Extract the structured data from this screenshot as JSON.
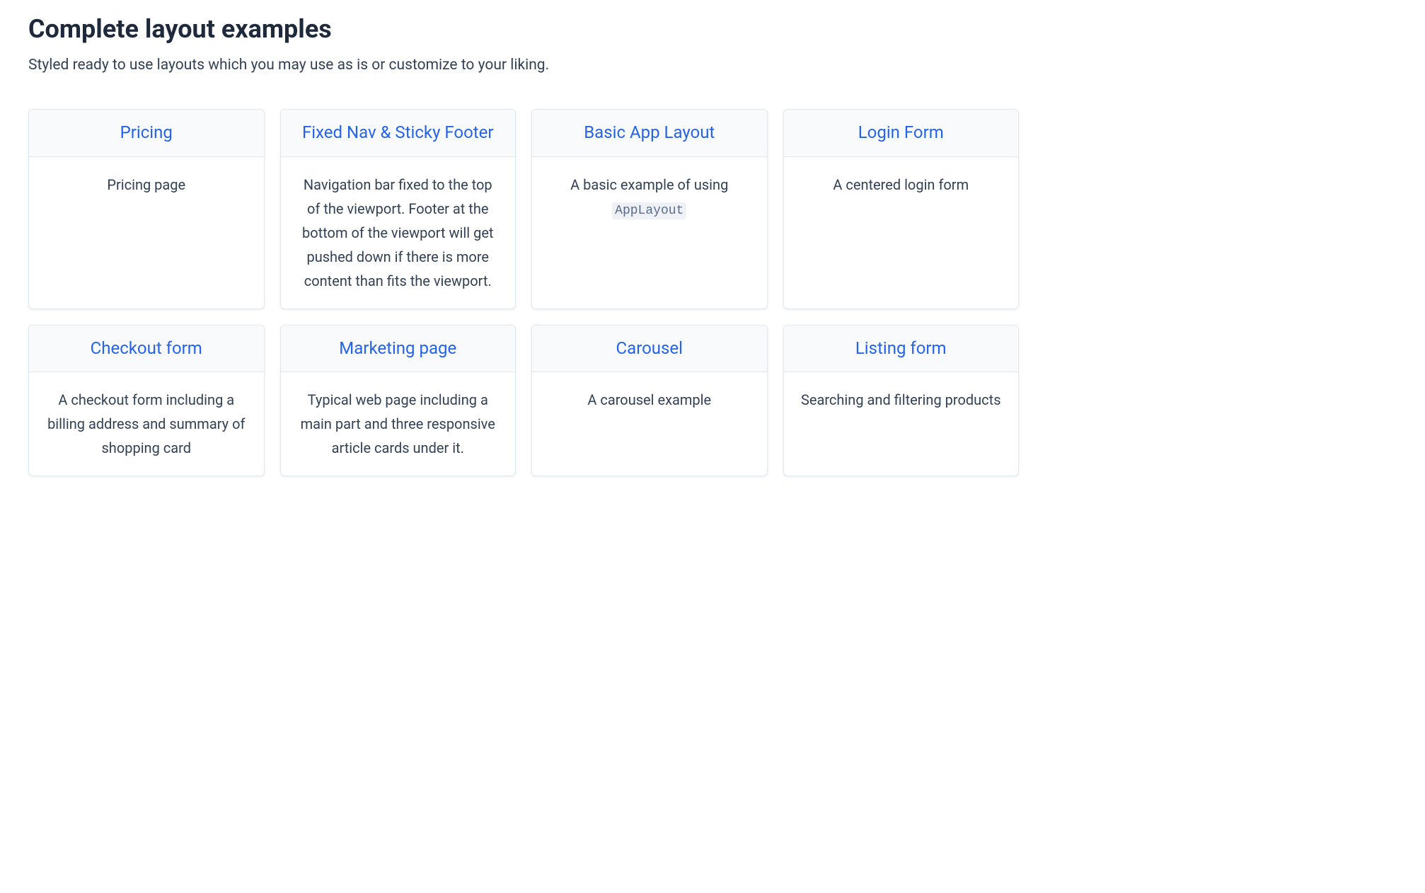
{
  "header": {
    "title": "Complete layout examples",
    "subtitle": "Styled ready to use layouts which you may use as is or customize to your liking."
  },
  "cards": [
    {
      "title": "Pricing",
      "description": "Pricing page",
      "code": null
    },
    {
      "title": "Fixed Nav & Sticky Footer",
      "description": "Navigation bar fixed to the top of the viewport. Footer at the bottom of the viewport will get pushed down if there is more content than fits the viewport.",
      "code": null
    },
    {
      "title": "Basic App Layout",
      "description": "A basic example of using ",
      "code": "AppLayout"
    },
    {
      "title": "Login Form",
      "description": "A centered login form",
      "code": null
    },
    {
      "title": "Checkout form",
      "description": "A checkout form including a billing address and summary of shopping card",
      "code": null
    },
    {
      "title": "Marketing page",
      "description": "Typical web page including a main part and three responsive article cards under it.",
      "code": null
    },
    {
      "title": "Carousel",
      "description": "A carousel example",
      "code": null
    },
    {
      "title": "Listing form",
      "description": "Searching and filtering products",
      "code": null
    }
  ]
}
